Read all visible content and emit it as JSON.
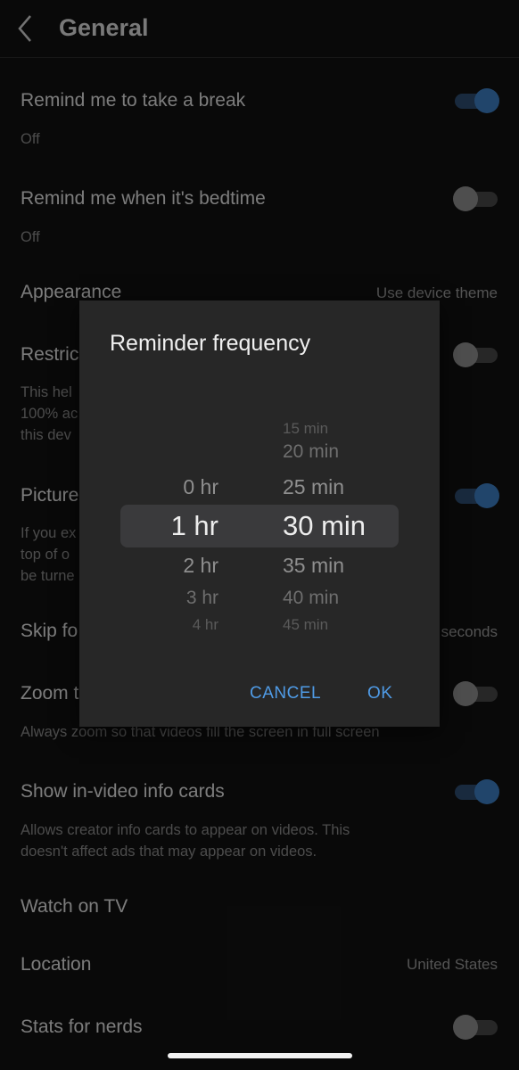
{
  "header": {
    "title": "General"
  },
  "settings": {
    "break": {
      "label": "Remind me to take a break",
      "sub": "Off"
    },
    "bedtime": {
      "label": "Remind me when it's bedtime",
      "sub": "Off"
    },
    "appearance": {
      "label": "Appearance",
      "value": "Use device theme"
    },
    "restricted": {
      "label": "Restric",
      "sub": "This hel\n100% ac\nthis dev"
    },
    "pip": {
      "label": "Picture",
      "sub": "If you ex\ntop of o\nbe turne"
    },
    "skip": {
      "label": "Skip fo",
      "value": "seconds"
    },
    "zoom": {
      "label": "Zoom t",
      "sub": "Always zoom so that videos fill the screen in full screen"
    },
    "infocards": {
      "label": "Show in-video info cards",
      "sub": "Allows creator info cards to appear on videos. This\ndoesn't affect ads that may appear on videos."
    },
    "watch_tv": {
      "label": "Watch on TV"
    },
    "location": {
      "label": "Location",
      "value": "United States"
    },
    "stats": {
      "label": "Stats for nerds"
    }
  },
  "toggles": {
    "break": true,
    "bedtime": false,
    "restricted": false,
    "pip": true,
    "zoom": false,
    "infocards": true,
    "stats": false
  },
  "dialog": {
    "title": "Reminder frequency",
    "hours": [
      "0 hr",
      "1 hr",
      "2 hr",
      "3 hr",
      "4 hr"
    ],
    "minutes": [
      "15 min",
      "20 min",
      "25 min",
      "30 min",
      "35 min",
      "40 min",
      "45 min"
    ],
    "selected_hour": "1 hr",
    "selected_minute": "30 min",
    "cancel_label": "CANCEL",
    "ok_label": "OK"
  },
  "colors": {
    "accent": "#3d7ec4",
    "link": "#4f9be6",
    "background": "#121212",
    "dialog": "#272727"
  }
}
